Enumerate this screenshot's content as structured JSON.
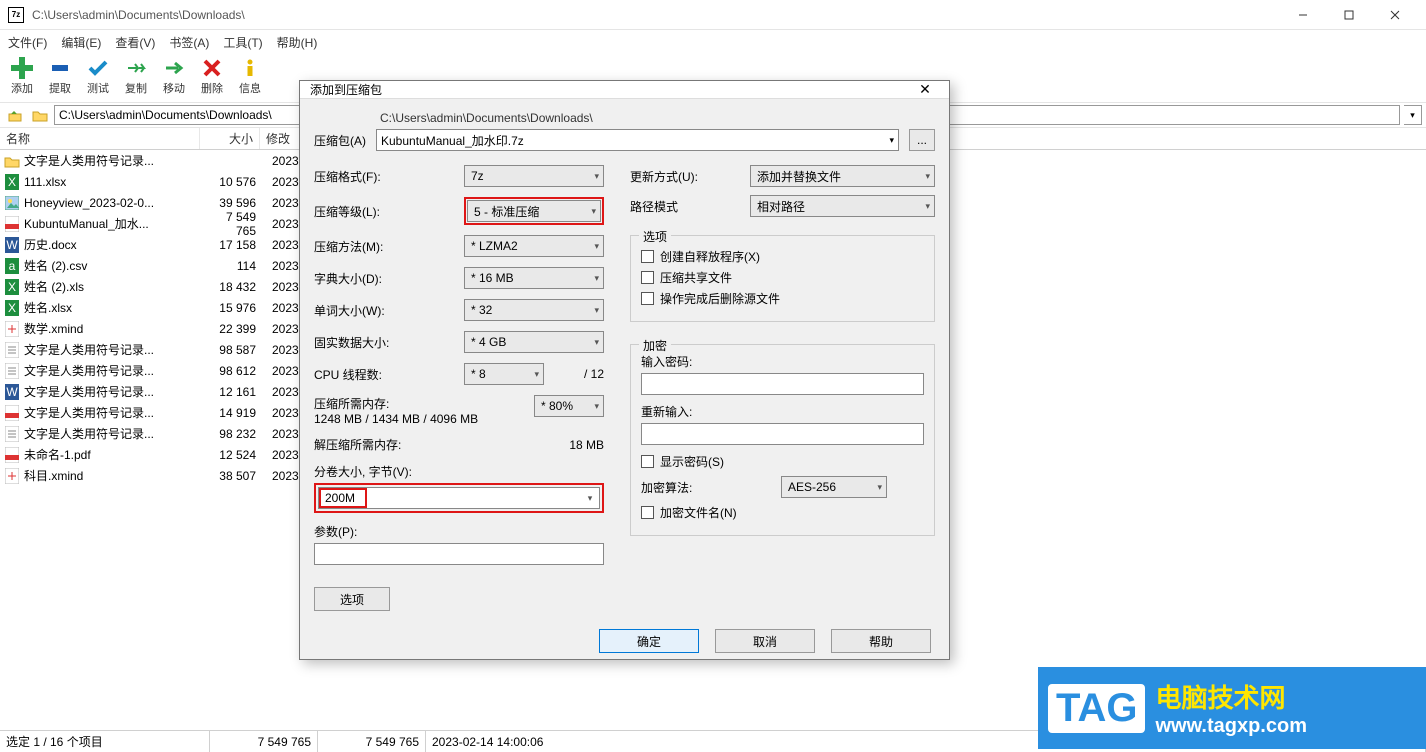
{
  "window": {
    "title": "C:\\Users\\admin\\Documents\\Downloads\\",
    "app_icon_text": "7z"
  },
  "menubar": {
    "file": "文件(F)",
    "edit": "编辑(E)",
    "view": "查看(V)",
    "bookmark": "书签(A)",
    "tools": "工具(T)",
    "help": "帮助(H)"
  },
  "toolbar": {
    "add": "添加",
    "extract": "提取",
    "test": "测试",
    "copy": "复制",
    "move": "移动",
    "delete": "删除",
    "info": "信息"
  },
  "path": "C:\\Users\\admin\\Documents\\Downloads\\",
  "columns": {
    "name": "名称",
    "size": "大小",
    "modified": "修改"
  },
  "files": [
    {
      "icon": "folder",
      "name": "文字是人类用符号记录...",
      "size": "",
      "date": "2023"
    },
    {
      "icon": "xlsx",
      "name": "111.xlsx",
      "size": "10 576",
      "date": "2023"
    },
    {
      "icon": "img",
      "name": "Honeyview_2023-02-0...",
      "size": "39 596",
      "date": "2023"
    },
    {
      "icon": "pdf",
      "name": "KubuntuManual_加水...",
      "size": "7 549 765",
      "date": "2023"
    },
    {
      "icon": "docx",
      "name": "历史.docx",
      "size": "17 158",
      "date": "2023"
    },
    {
      "icon": "csv",
      "name": "姓名 (2).csv",
      "size": "114",
      "date": "2023"
    },
    {
      "icon": "xls",
      "name": "姓名 (2).xls",
      "size": "18 432",
      "date": "2023"
    },
    {
      "icon": "xlsx",
      "name": "姓名.xlsx",
      "size": "15 976",
      "date": "2023"
    },
    {
      "icon": "xmind",
      "name": "数学.xmind",
      "size": "22 399",
      "date": "2023"
    },
    {
      "icon": "txt",
      "name": "文字是人类用符号记录...",
      "size": "98 587",
      "date": "2023"
    },
    {
      "icon": "txt",
      "name": "文字是人类用符号记录...",
      "size": "98 612",
      "date": "2023"
    },
    {
      "icon": "docx2",
      "name": "文字是人类用符号记录...",
      "size": "12 161",
      "date": "2023"
    },
    {
      "icon": "pdf",
      "name": "文字是人类用符号记录...",
      "size": "14 919",
      "date": "2023"
    },
    {
      "icon": "txt",
      "name": "文字是人类用符号记录...",
      "size": "98 232",
      "date": "2023"
    },
    {
      "icon": "pdf",
      "name": "未命名-1.pdf",
      "size": "12 524",
      "date": "2023"
    },
    {
      "icon": "xmind",
      "name": "科目.xmind",
      "size": "38 507",
      "date": "2023"
    }
  ],
  "status": {
    "sel": "选定 1 / 16 个项目",
    "s1": "7 549 765",
    "s2": "7 549 765",
    "date": "2023-02-14 14:00:06"
  },
  "dialog": {
    "title": "添加到压缩包",
    "archive_label": "压缩包(A)",
    "path_display": "C:\\Users\\admin\\Documents\\Downloads\\",
    "archive_name": "KubuntuManual_加水印.7z",
    "browse": "...",
    "format_label": "压缩格式(F):",
    "format": "7z",
    "level_label": "压缩等级(L):",
    "level": "5 - 标准压缩",
    "method_label": "压缩方法(M):",
    "method": "* LZMA2",
    "dict_label": "字典大小(D):",
    "dict": "* 16 MB",
    "word_label": "单词大小(W):",
    "word": "* 32",
    "solid_label": "固实数据大小:",
    "solid": "* 4 GB",
    "cpu_label": "CPU 线程数:",
    "cpu": "* 8",
    "cpu_total": "/ 12",
    "mem_label": "压缩所需内存:",
    "mem_val": "1248 MB / 1434 MB / 4096 MB",
    "mem_pct": "* 80%",
    "decomp_label": "解压缩所需内存:",
    "decomp_val": "18 MB",
    "split_label": "分卷大小, 字节(V):",
    "split_val": "200M",
    "param_label": "参数(P):",
    "options_btn": "选项",
    "update_label": "更新方式(U):",
    "update": "添加并替换文件",
    "pathmode_label": "路径模式",
    "pathmode": "相对路径",
    "options_group": "选项",
    "opt_sfx": "创建自释放程序(X)",
    "opt_shared": "压缩共享文件",
    "opt_delete": "操作完成后删除源文件",
    "encrypt_group": "加密",
    "pw_label": "输入密码:",
    "pw2_label": "重新输入:",
    "showpw": "显示密码(S)",
    "enc_method_label": "加密算法:",
    "enc_method": "AES-256",
    "enc_names": "加密文件名(N)",
    "ok": "确定",
    "cancel": "取消",
    "help": "帮助"
  },
  "watermark": {
    "tag": "TAG",
    "line1": "电脑技术网",
    "line2": "www.tagxp.com"
  }
}
